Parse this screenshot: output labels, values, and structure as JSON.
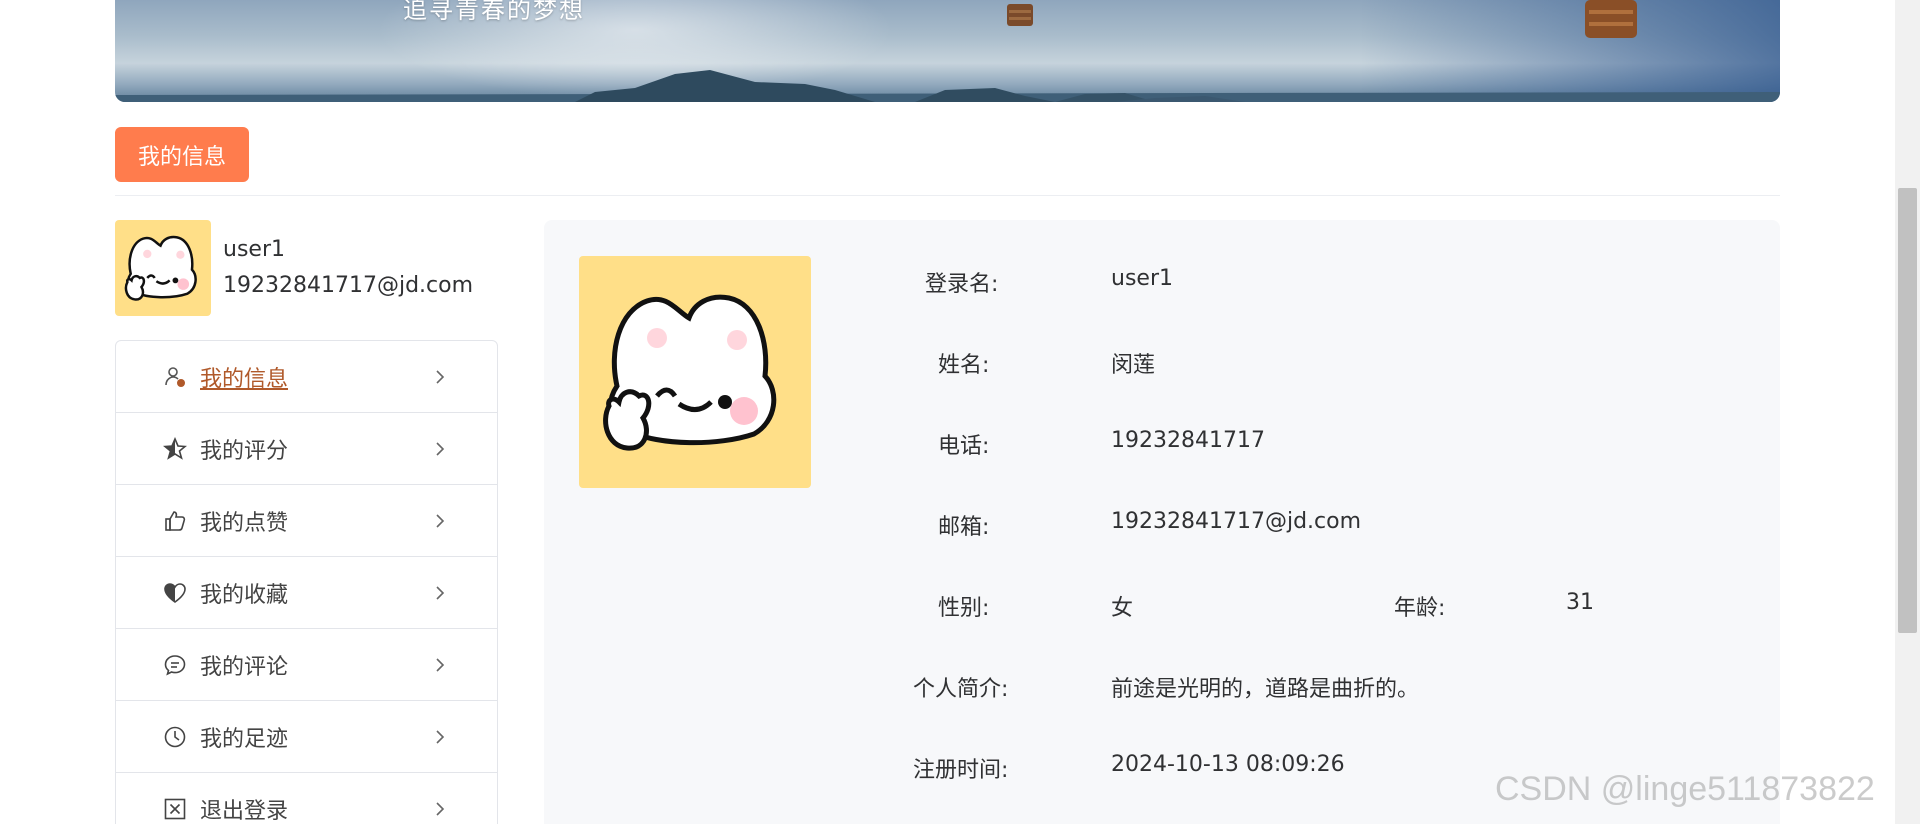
{
  "banner": {
    "slogan": "追寻青春的梦想"
  },
  "tab": {
    "label": "我的信息"
  },
  "user": {
    "username": "user1",
    "email": "19232841717@jd.com"
  },
  "menu": {
    "items": [
      {
        "label": "我的信息",
        "icon": "user-icon",
        "active": true
      },
      {
        "label": "我的评分",
        "icon": "star-icon",
        "active": false
      },
      {
        "label": "我的点赞",
        "icon": "thumb-up-icon",
        "active": false
      },
      {
        "label": "我的收藏",
        "icon": "heart-icon",
        "active": false
      },
      {
        "label": "我的评论",
        "icon": "chat-icon",
        "active": false
      },
      {
        "label": "我的足迹",
        "icon": "clock-icon",
        "active": false
      },
      {
        "label": "退出登录",
        "icon": "close-box-icon",
        "active": false
      }
    ]
  },
  "profile": {
    "login_label": "登录名:",
    "login_value": "user1",
    "name_label": "姓名:",
    "name_value": "闵莲",
    "phone_label": "电话:",
    "phone_value": "19232841717",
    "email_label": "邮箱:",
    "email_value": "19232841717@jd.com",
    "gender_label": "性别:",
    "gender_value": "女",
    "age_label": "年龄:",
    "age_value": "31",
    "bio_label": "个人简介:",
    "bio_value": "前途是光明的，道路是曲折的。",
    "register_label": "注册时间:",
    "register_value": "2024-10-13 08:09:26"
  },
  "watermark": "CSDN @linge511873822",
  "colors": {
    "accent": "#ff7c4d",
    "active_link": "#b0592a",
    "avatar_bg": "#ffdf88",
    "panel_bg": "#f7f8fa"
  }
}
